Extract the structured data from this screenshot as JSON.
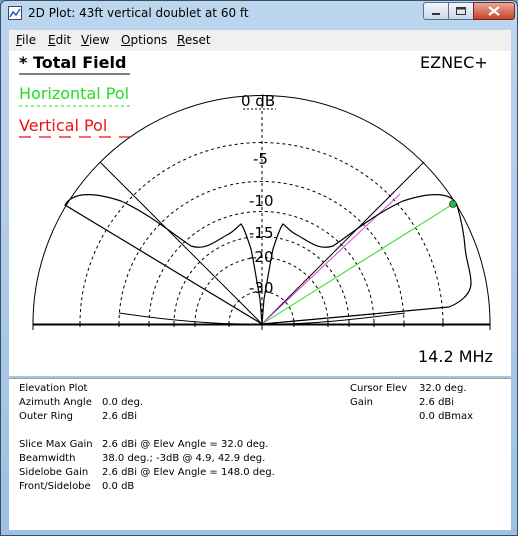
{
  "window": {
    "title": "2D Plot: 43ft vertical doublet at 60 ft"
  },
  "menu": [
    {
      "label": "File",
      "hotkey": "F",
      "rest": "ile"
    },
    {
      "label": "Edit",
      "hotkey": "E",
      "rest": "dit"
    },
    {
      "label": "View",
      "hotkey": "V",
      "rest": "iew"
    },
    {
      "label": "Options",
      "hotkey": "O",
      "rest": "ptions"
    },
    {
      "label": "Reset",
      "hotkey": "R",
      "rest": "eset"
    }
  ],
  "plot": {
    "total_field_label": "* Total Field",
    "horizontal_label": "Horizontal Pol",
    "vertical_label": "Vertical Pol",
    "brand": "EZNEC+",
    "frequency": "14.2 MHz",
    "ring_labels": [
      "0 dB",
      "-5",
      "-10",
      "-15",
      "-20",
      "-30"
    ],
    "colors": {
      "horizontal": "#22dd22",
      "vertical": "#ee1111",
      "cyan_line": "#22ccee",
      "magenta_line": "#dd44dd",
      "cursor_marker": "#22bb44"
    }
  },
  "info": {
    "left": [
      {
        "label": "Elevation Plot",
        "value": ""
      },
      {
        "label": "Azimuth Angle",
        "value": "0.0 deg."
      },
      {
        "label": "Outer Ring",
        "value": "2.6 dBi"
      },
      {
        "label": "Slice Max Gain",
        "value": "2.6 dBi @ Elev Angle = 32.0 deg."
      },
      {
        "label": "Beamwidth",
        "value": "38.0 deg.; -3dB @ 4.9, 42.9 deg."
      },
      {
        "label": "Sidelobe Gain",
        "value": "2.6 dBi @ Elev Angle = 148.0 deg."
      },
      {
        "label": "Front/Sidelobe",
        "value": "0.0 dB"
      }
    ],
    "right": [
      {
        "label": "Cursor Elev",
        "value": "32.0 deg."
      },
      {
        "label": "Gain",
        "value": "2.6 dBi"
      },
      {
        "label": "",
        "value": "0.0 dBmax"
      }
    ]
  }
}
